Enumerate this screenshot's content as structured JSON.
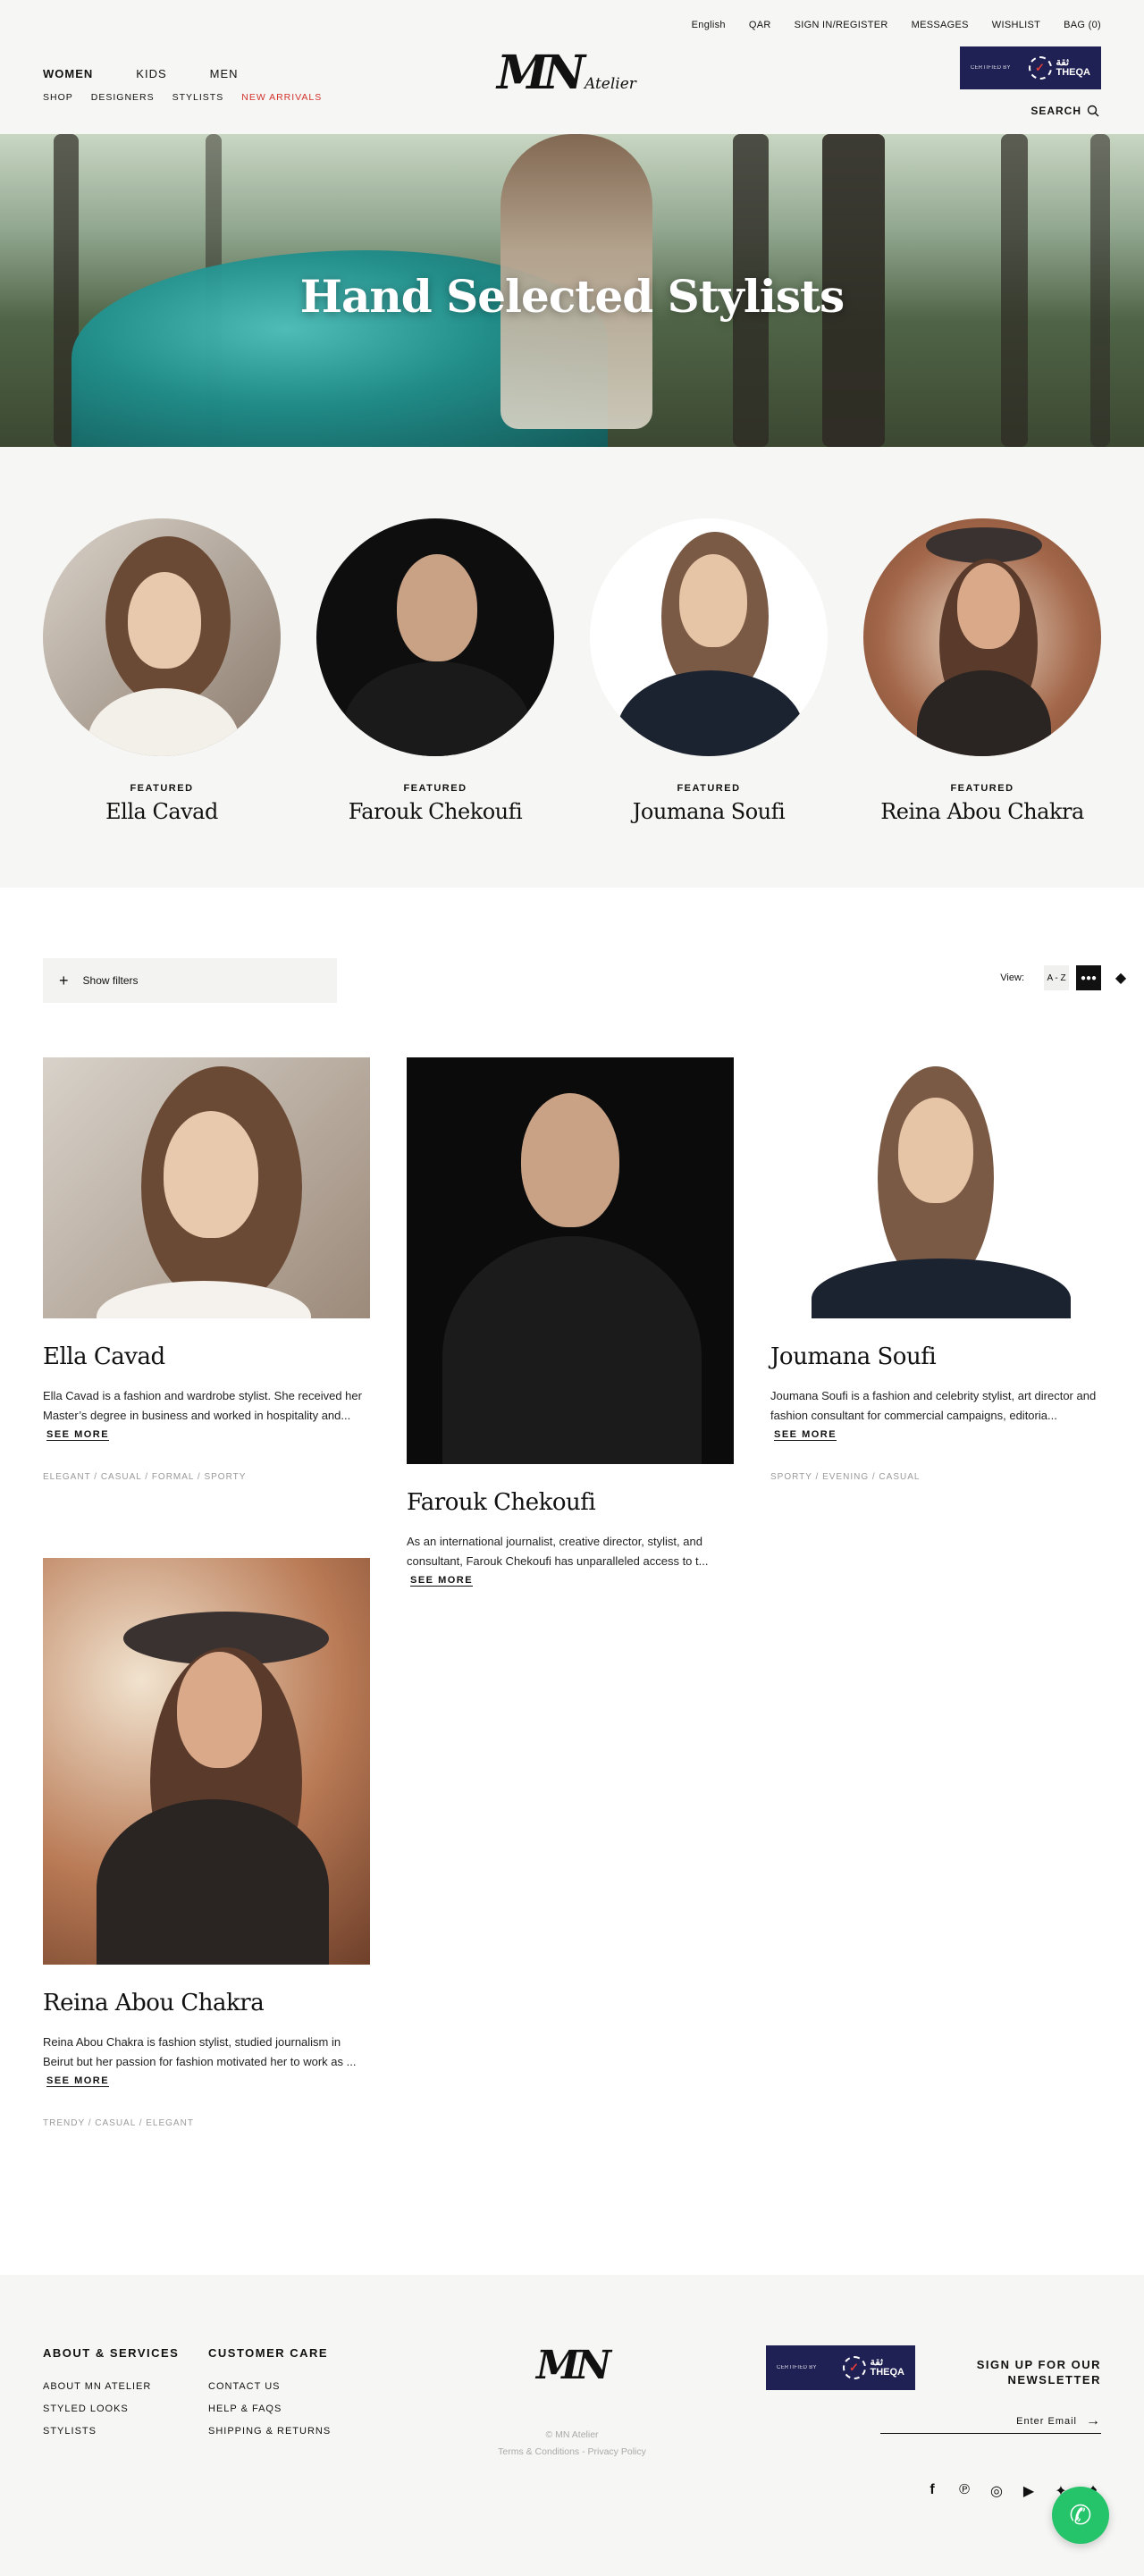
{
  "header": {
    "utility": [
      "English",
      "QAR",
      "SIGN IN/REGISTER",
      "MESSAGES",
      "WISHLIST",
      "BAG (0)"
    ],
    "main_nav": [
      "WOMEN",
      "KIDS",
      "MEN"
    ],
    "sub_nav": [
      "SHOP",
      "DESIGNERS",
      "STYLISTS",
      "NEW ARRIVALS"
    ],
    "logo_mark": "MN",
    "logo_text": "Atelier",
    "badge_small": "CERTIFIED BY",
    "badge_word1": "ثقة",
    "badge_word2": "THEQA",
    "search": "SEARCH"
  },
  "hero": {
    "title": "Hand Selected Stylists"
  },
  "featured": {
    "label": "FEATURED",
    "names": [
      "Ella Cavad",
      "Farouk Chekoufi",
      "Joumana Soufi",
      "Reina Abou Chakra"
    ]
  },
  "toolbar": {
    "show_filters": "Show filters",
    "view_label": "View:",
    "view_az": "A - Z"
  },
  "stylists": [
    {
      "name": "Ella Cavad",
      "desc": "Ella Cavad is a fashion and wardrobe stylist. She received her Master’s degree in business and worked in hospitality and...",
      "more": "SEE MORE",
      "tags": "ELEGANT  /  CASUAL  /  FORMAL  /  SPORTY"
    },
    {
      "name": "Farouk Chekoufi",
      "desc": "As an international journalist, creative director, stylist, and consultant, Farouk Chekoufi has unparalleled access to t...",
      "more": "SEE MORE",
      "tags": ""
    },
    {
      "name": "Joumana Soufi",
      "desc": "Joumana Soufi is a fashion and celebrity stylist, art director and fashion consultant for commercial campaigns, editoria...",
      "more": "SEE MORE",
      "tags": "SPORTY  /  EVENING  /  CASUAL"
    },
    {
      "name": "Reina Abou Chakra",
      "desc": "Reina Abou Chakra is fashion stylist, studied journalism in Beirut but her passion for fashion motivated her to work as ...",
      "more": "SEE MORE",
      "tags": "TRENDY  /  CASUAL  /  ELEGANT"
    }
  ],
  "footer": {
    "col1_title": "ABOUT & SERVICES",
    "col1_links": [
      "ABOUT MN ATELIER",
      "STYLED LOOKS",
      "STYLISTS"
    ],
    "col2_title": "CUSTOMER CARE",
    "col2_links": [
      "CONTACT US",
      "HELP & FAQS",
      "SHIPPING & RETURNS"
    ],
    "logo_mark": "MN",
    "copyright": "© MN Atelier",
    "legal": "Terms & Conditions - Privacy Policy",
    "newsletter_line1": "SIGN UP FOR OUR",
    "newsletter_line2": "NEWSLETTER",
    "email_label": "Enter Email",
    "social": [
      "facebook-icon",
      "pinterest-icon",
      "instagram-icon",
      "youtube-icon",
      "twitter-icon",
      "snapchat-icon"
    ]
  },
  "colors": {
    "accent_red": "#d2322b",
    "theqa_navy": "#1f2054",
    "whatsapp_green": "#25c46a",
    "panel": "#f6f6f4"
  }
}
